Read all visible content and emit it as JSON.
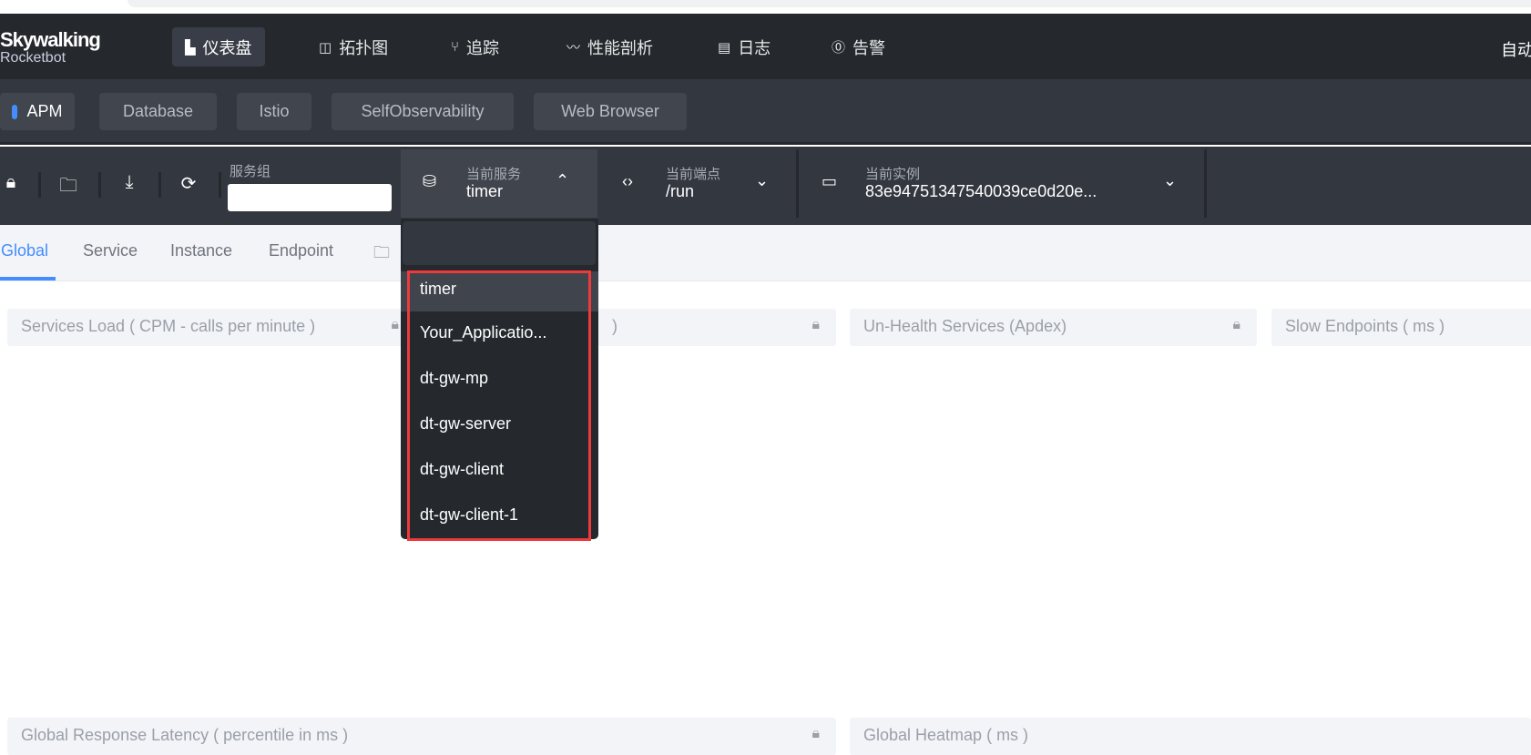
{
  "logo": {
    "name": "Skywalking",
    "subtitle": "Rocketbot"
  },
  "nav": [
    {
      "label": "仪表盘",
      "icon": "chart-icon",
      "active": true
    },
    {
      "label": "拓扑图",
      "icon": "topology-icon"
    },
    {
      "label": "追踪",
      "icon": "trace-icon"
    },
    {
      "label": "性能剖析",
      "icon": "profile-icon"
    },
    {
      "label": "日志",
      "icon": "log-icon"
    },
    {
      "label": "告警",
      "icon": "alarm-icon"
    }
  ],
  "header_right": "自动",
  "layers": [
    {
      "label": "APM",
      "active": true
    },
    {
      "label": "Database"
    },
    {
      "label": "Istio"
    },
    {
      "label": "SelfObservability"
    },
    {
      "label": "Web Browser"
    }
  ],
  "toolbar": {
    "group_label": "服务组",
    "group_value": "",
    "service": {
      "label": "当前服务",
      "value": "timer"
    },
    "endpoint": {
      "label": "当前端点",
      "value": "/run"
    },
    "instance": {
      "label": "当前实例",
      "value": "83e94751347540039ce0d20e..."
    }
  },
  "tabs": [
    "Global",
    "Service",
    "Instance",
    "Endpoint"
  ],
  "cards": [
    "Services Load ( CPM - calls per minute )",
    ")",
    "Un-Health Services (Apdex)",
    "Slow Endpoints ( ms )",
    "Global Response Latency ( percentile in ms )",
    "Global Heatmap ( ms )"
  ],
  "service_dropdown": {
    "search_value": "",
    "items": [
      "timer",
      "Your_Applicatio...",
      "dt-gw-mp",
      "dt-gw-server",
      "dt-gw-client",
      "dt-gw-client-1"
    ],
    "selected": "timer"
  },
  "colors": {
    "accent": "#448dfe",
    "header": "#25292e",
    "toolbar": "#333840",
    "highlight_box": "#f0393b"
  }
}
